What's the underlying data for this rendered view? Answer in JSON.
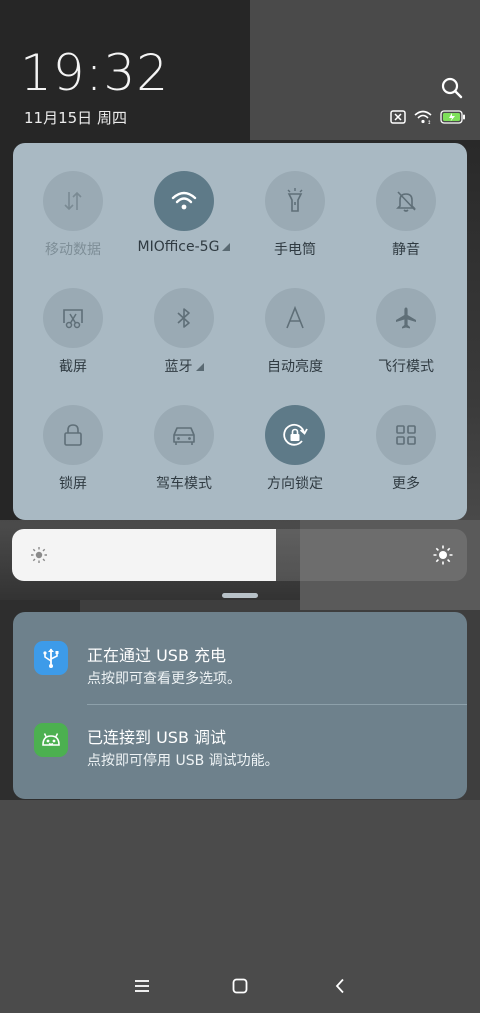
{
  "status": {
    "time": "19:32",
    "date": "11月15日 周四"
  },
  "quick_settings": [
    {
      "id": "mobile-data",
      "label": "移动数据",
      "icon": "mobile-data-icon",
      "active": false,
      "disabled": true,
      "has_menu": false
    },
    {
      "id": "wifi",
      "label": "MIOffice-5G",
      "icon": "wifi-icon",
      "active": true,
      "disabled": false,
      "has_menu": true
    },
    {
      "id": "flashlight",
      "label": "手电筒",
      "icon": "flashlight-icon",
      "active": false,
      "disabled": false,
      "has_menu": false
    },
    {
      "id": "silent",
      "label": "静音",
      "icon": "bell-off-icon",
      "active": false,
      "disabled": false,
      "has_menu": false
    },
    {
      "id": "screenshot",
      "label": "截屏",
      "icon": "screenshot-icon",
      "active": false,
      "disabled": false,
      "has_menu": false
    },
    {
      "id": "bluetooth",
      "label": "蓝牙",
      "icon": "bluetooth-icon",
      "active": false,
      "disabled": false,
      "has_menu": true
    },
    {
      "id": "auto-brightness",
      "label": "自动亮度",
      "icon": "auto-brightness-icon",
      "active": false,
      "disabled": false,
      "has_menu": false
    },
    {
      "id": "airplane",
      "label": "飞行模式",
      "icon": "airplane-icon",
      "active": false,
      "disabled": false,
      "has_menu": false
    },
    {
      "id": "lock-screen",
      "label": "锁屏",
      "icon": "lock-icon",
      "active": false,
      "disabled": false,
      "has_menu": false
    },
    {
      "id": "driving-mode",
      "label": "驾车模式",
      "icon": "car-icon",
      "active": false,
      "disabled": false,
      "has_menu": false
    },
    {
      "id": "rotation-lock",
      "label": "方向锁定",
      "icon": "rotation-lock-icon",
      "active": true,
      "disabled": false,
      "has_menu": false
    },
    {
      "id": "more",
      "label": "更多",
      "icon": "grid-icon",
      "active": false,
      "disabled": false,
      "has_menu": false
    }
  ],
  "brightness": {
    "level": 0.58
  },
  "notifications": [
    {
      "title": "正在通过 USB 充电",
      "body": "点按即可查看更多选项。",
      "icon": "usb-icon",
      "icon_color": "#3d9be9"
    },
    {
      "title": "已连接到 USB 调试",
      "body": "点按即可停用 USB 调试功能。",
      "icon": "android-icon",
      "icon_color": "#4cb050"
    }
  ],
  "colors": {
    "panel": "#a9b9c3",
    "tile_inactive": "#9aaab4",
    "tile_active": "#5e7a88",
    "notification_panel": "#6e818c",
    "battery_green": "#7ee05a"
  }
}
